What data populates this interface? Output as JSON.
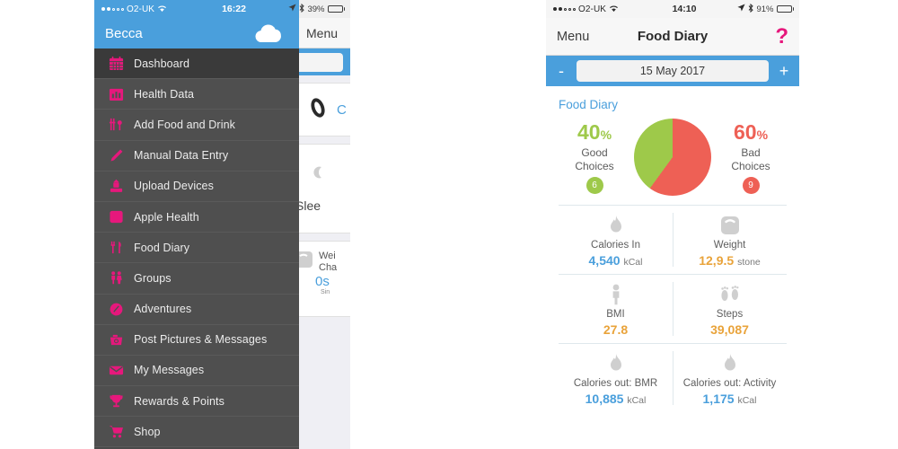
{
  "colors": {
    "pink": "#e6187c",
    "blue": "#4a9fdc",
    "green": "#9ec94a",
    "red": "#ee6055",
    "orange": "#e9a33a",
    "value_blue": "#4a9fdc",
    "drawer_bg": "#4f4f4f",
    "drawer_active": "#3a3a3a"
  },
  "left_phone": {
    "status_bar": {
      "carrier": "O2-UK",
      "time": "16:22",
      "battery_text": "39%",
      "battery_level": 39,
      "signal_filled": 2,
      "signal_total": 5,
      "wifi_icon": "wifi-icon",
      "location_icon": "location-arrow-icon",
      "bluetooth_icon": "bluetooth-icon"
    },
    "drawer": {
      "user_name": "Becca",
      "cloud_icon": "cloud-icon",
      "items": [
        {
          "label": "Dashboard",
          "icon": "calendar-icon",
          "active": true
        },
        {
          "label": "Health Data",
          "icon": "bar-chart-icon",
          "active": false
        },
        {
          "label": "Add Food and Drink",
          "icon": "cutlery-slider-icon",
          "active": false
        },
        {
          "label": "Manual Data Entry",
          "icon": "pencil-icon",
          "active": false
        },
        {
          "label": "Upload Devices",
          "icon": "upload-device-icon",
          "active": false
        },
        {
          "label": "Apple Health",
          "icon": "heart-icon",
          "active": false
        },
        {
          "label": "Food Diary",
          "icon": "fork-knife-icon",
          "active": false
        },
        {
          "label": "Groups",
          "icon": "people-icon",
          "active": false
        },
        {
          "label": "Adventures",
          "icon": "compass-icon",
          "active": false
        },
        {
          "label": "Post Pictures & Messages",
          "icon": "camera-icon",
          "active": false
        },
        {
          "label": "My Messages",
          "icon": "envelope-icon",
          "active": false
        },
        {
          "label": "Rewards & Points",
          "icon": "trophy-icon",
          "active": false
        },
        {
          "label": "Shop",
          "icon": "shopping-cart-icon",
          "active": false
        }
      ]
    },
    "background_content": {
      "menu_label": "Menu",
      "minus_label": "-",
      "card1_text": "C",
      "card1_icon": "wristband-icon",
      "card2_text": "Slee",
      "card2_icon": "moon-icon",
      "card3_title_line1": "Wei",
      "card3_title_line2": "Cha",
      "card3_value": "0s",
      "card3_sub": "Sin",
      "card3_icon": "scale-icon"
    }
  },
  "right_phone": {
    "status_bar": {
      "carrier": "O2-UK",
      "time": "14:10",
      "battery_text": "91%",
      "battery_level": 91,
      "signal_filled": 2,
      "signal_total": 5,
      "wifi_icon": "wifi-icon",
      "location_icon": "location-arrow-icon",
      "bluetooth_icon": "bluetooth-icon"
    },
    "nav": {
      "menu_label": "Menu",
      "title": "Food Diary",
      "help_label": "?"
    },
    "date_bar": {
      "prev_label": "-",
      "date": "15 May 2017",
      "next_label": "+"
    },
    "section_title": "Food Diary",
    "choices": {
      "good": {
        "percent": "40",
        "percent_symbol": "%",
        "label_line1": "Good",
        "label_line2": "Choices",
        "count": "6",
        "color": "#9ec94a"
      },
      "bad": {
        "percent": "60",
        "percent_symbol": "%",
        "label_line1": "Bad",
        "label_line2": "Choices",
        "count": "9",
        "color": "#ee6055"
      }
    },
    "stats": [
      [
        {
          "label": "Calories In",
          "value": "4,540",
          "unit": "kCal",
          "color": "#4a9fdc",
          "icon": "flame-icon"
        },
        {
          "label": "Weight",
          "value": "12,9.5",
          "unit": "stone",
          "color": "#e9a33a",
          "icon": "scale-icon"
        }
      ],
      [
        {
          "label": "BMI",
          "value": "27.8",
          "unit": "",
          "color": "#e9a33a",
          "icon": "person-icon"
        },
        {
          "label": "Steps",
          "value": "39,087",
          "unit": "",
          "color": "#e9a33a",
          "icon": "footprints-icon"
        }
      ],
      [
        {
          "label": "Calories out: BMR",
          "value": "10,885",
          "unit": "kCal",
          "color": "#4a9fdc",
          "icon": "flame-icon"
        },
        {
          "label": "Calories out: Activity",
          "value": "1,175",
          "unit": "kCal",
          "color": "#4a9fdc",
          "icon": "flame-icon"
        }
      ]
    ]
  },
  "chart_data": {
    "type": "pie",
    "title": "Food Diary",
    "labels": [
      "Good Choices",
      "Bad Choices"
    ],
    "values": [
      40,
      60
    ],
    "counts": [
      6,
      9
    ],
    "colors": [
      "#9ec94a",
      "#ee6055"
    ],
    "units": "percent",
    "legend": "flanking",
    "grid": false
  }
}
